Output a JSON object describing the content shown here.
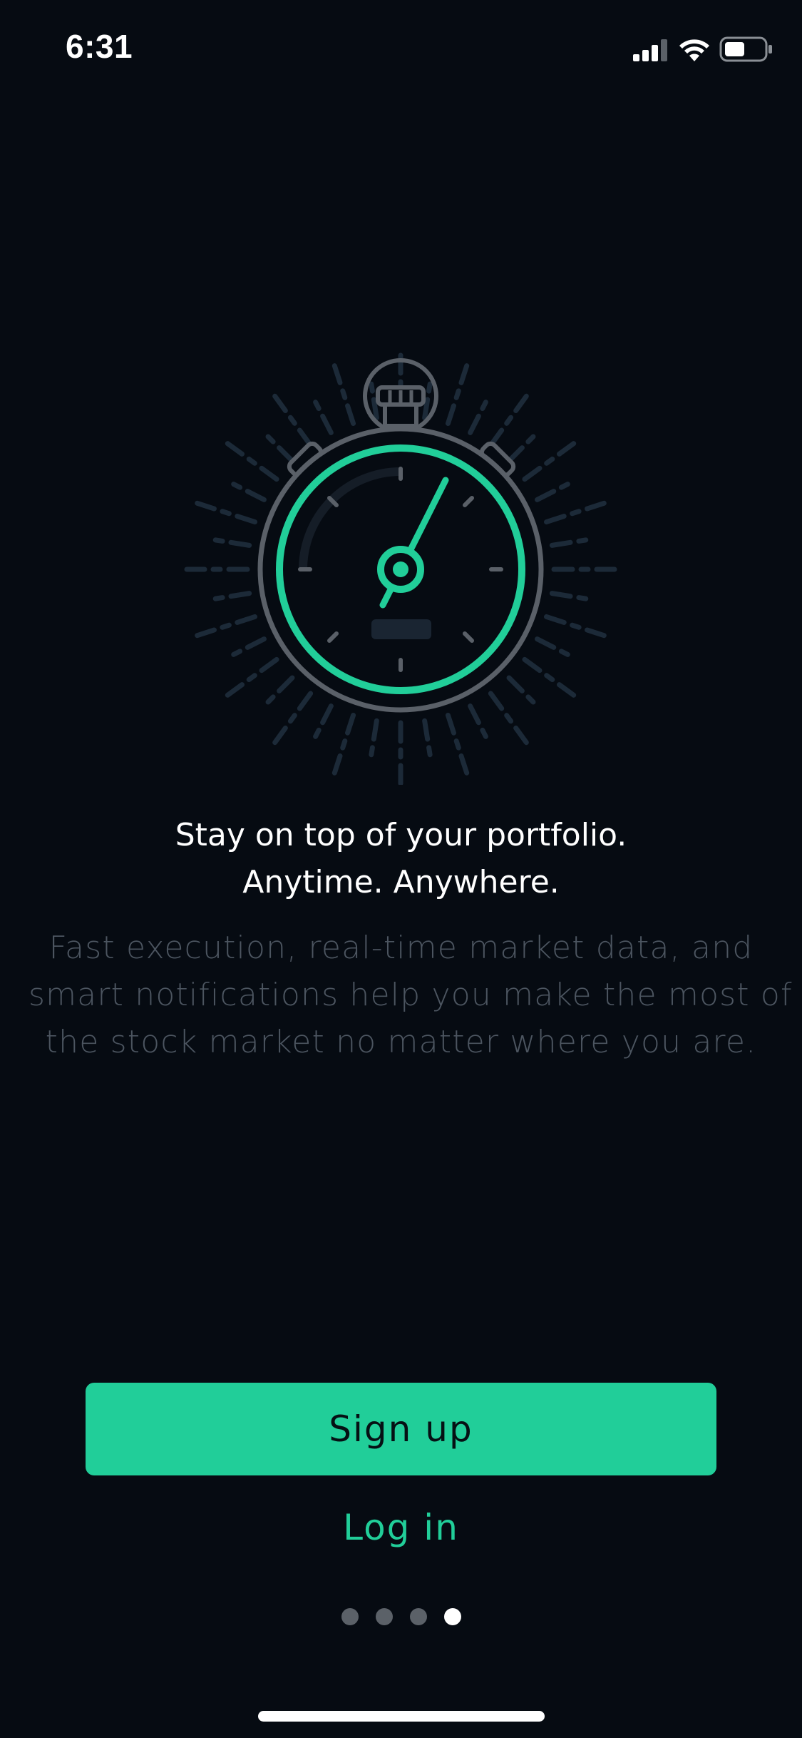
{
  "status_bar": {
    "time": "6:31",
    "icons": [
      "cellular-signal-icon",
      "wifi-icon",
      "battery-icon"
    ]
  },
  "illustration": {
    "icon": "stopwatch-icon",
    "accent_color": "#21ce99"
  },
  "headline": {
    "line1": "Stay on top of your portfolio.",
    "line2": "Anytime. Anywhere."
  },
  "description": {
    "line1": "Fast execution, real-time market data, and",
    "line2": "smart notifications help you make the most of",
    "line3": "the stock market no matter where you are."
  },
  "actions": {
    "signup_label": "Sign up",
    "login_label": "Log in"
  },
  "pager": {
    "total": 4,
    "active_index": 3
  },
  "colors": {
    "background": "#060b12",
    "accent": "#21ce99",
    "muted_text": "#4c5560"
  }
}
